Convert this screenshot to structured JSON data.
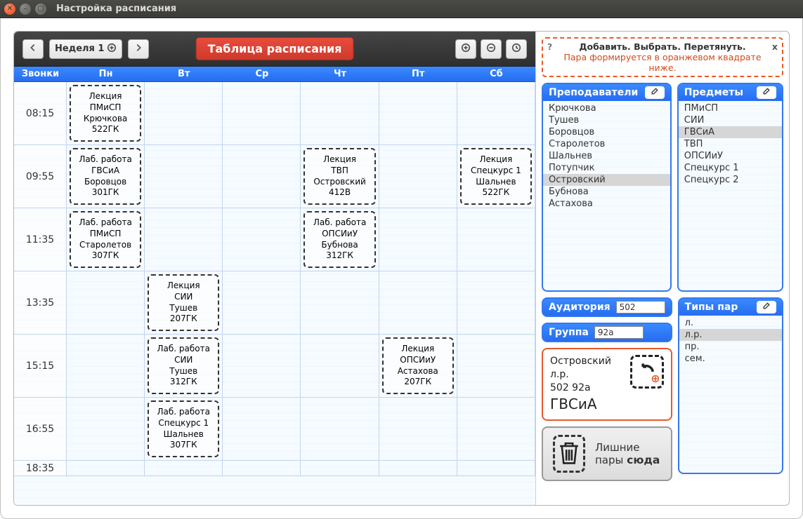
{
  "window": {
    "title": "Настройка расписания"
  },
  "toolbar": {
    "week_label": "Неделя 1",
    "title": "Таблица расписания"
  },
  "schedule": {
    "time_column_header": "Звонки",
    "days": [
      "Пн",
      "Вт",
      "Ср",
      "Чт",
      "Пт",
      "Сб"
    ],
    "times": [
      "08:15",
      "09:55",
      "11:35",
      "13:35",
      "15:15",
      "16:55",
      "18:35"
    ],
    "lessons": [
      {
        "time": 0,
        "day": 0,
        "type": "Лекция",
        "subject": "ПМиСП",
        "teacher": "Крючкова",
        "room": "522ГК"
      },
      {
        "time": 1,
        "day": 0,
        "type": "Лаб. работа",
        "subject": "ГВСиА",
        "teacher": "Боровцов",
        "room": "301ГК"
      },
      {
        "time": 1,
        "day": 3,
        "type": "Лекция",
        "subject": "ТВП",
        "teacher": "Островский",
        "room": "412В"
      },
      {
        "time": 1,
        "day": 5,
        "type": "Лекция",
        "subject": "Спецкурс 1",
        "teacher": "Шальнев",
        "room": "522ГК"
      },
      {
        "time": 2,
        "day": 0,
        "type": "Лаб. работа",
        "subject": "ПМиСП",
        "teacher": "Старолетов",
        "room": "307ГК"
      },
      {
        "time": 2,
        "day": 3,
        "type": "Лаб. работа",
        "subject": "ОПСИиУ",
        "teacher": "Бубнова",
        "room": "312ГК"
      },
      {
        "time": 3,
        "day": 1,
        "type": "Лекция",
        "subject": "СИИ",
        "teacher": "Тушев",
        "room": "207ГК"
      },
      {
        "time": 4,
        "day": 1,
        "type": "Лаб. работа",
        "subject": "СИИ",
        "teacher": "Тушев",
        "room": "312ГК"
      },
      {
        "time": 4,
        "day": 4,
        "type": "Лекция",
        "subject": "ОПСИиУ",
        "teacher": "Астахова",
        "room": "207ГК"
      },
      {
        "time": 5,
        "day": 1,
        "type": "Лаб. работа",
        "subject": "Спецкурс 1",
        "teacher": "Шальнев",
        "room": "307ГК"
      }
    ]
  },
  "hint": {
    "q": "?",
    "x": "x",
    "line1": "Добавить. Выбрать. Перетянуть.",
    "line2": "Пара формируется в оранжевом квадрате ниже."
  },
  "teachers": {
    "title": "Преподаватели",
    "items": [
      "Крючкова",
      "Тушев",
      "Боровцов",
      "Старолетов",
      "Шальнев",
      "Потупчик",
      "Островский",
      "Бубнова",
      "Астахова"
    ],
    "selected_index": 6
  },
  "subjects": {
    "title": "Предметы",
    "items": [
      "ПМиСП",
      "СИИ",
      "ГВСиА",
      "ТВП",
      "ОПСИиУ",
      "Спецкурс 1",
      "Спецкурс 2"
    ],
    "selected_index": 2
  },
  "room": {
    "title": "Аудитория",
    "value": "502"
  },
  "group": {
    "title": "Группа",
    "value": "92а"
  },
  "types": {
    "title": "Типы пар",
    "items": [
      "л.",
      "л.р.",
      "пр.",
      "сем."
    ],
    "selected_index": 1
  },
  "preview": {
    "teacher": "Островский",
    "type": "л.р.",
    "room_group": "502 92а",
    "subject": "ГВСиА"
  },
  "trash": {
    "line1": "Лишние",
    "line2_a": "пары ",
    "line2_b": "сюда"
  }
}
